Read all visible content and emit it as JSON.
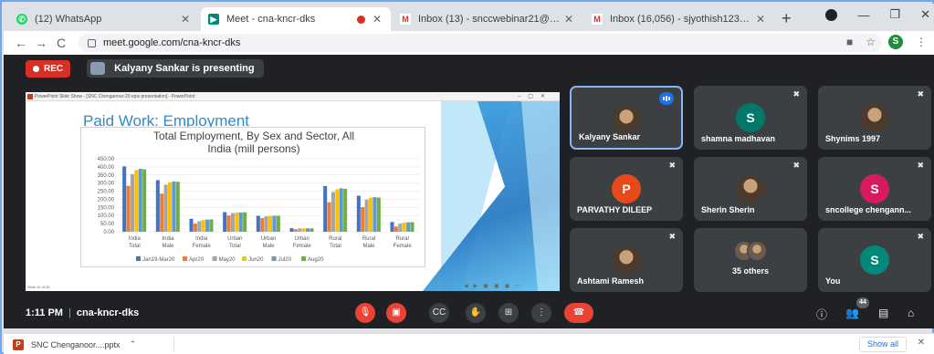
{
  "browser": {
    "tabs": [
      {
        "title": "(12) WhatsApp",
        "favicon": "whatsapp-icon",
        "color": "#25d366"
      },
      {
        "title": "Meet - cna-kncr-dks",
        "favicon": "meet-icon",
        "color": "#00897b"
      },
      {
        "title": "Inbox (13) - snccwebinar21@gm",
        "favicon": "gmail-icon",
        "color": "#d93025"
      },
      {
        "title": "Inbox (16,056) - sjyothish123@g",
        "favicon": "gmail-icon",
        "color": "#d93025"
      }
    ],
    "url": "meet.google.com/cna-kncr-dks",
    "profile_initial": "S"
  },
  "meet": {
    "rec_label": "REC",
    "presenting_label": "Kalyany Sankar is presenting",
    "time": "1:11 PM",
    "meeting_code": "cna-kncr-dks",
    "participant_count": "44"
  },
  "slide": {
    "window_title": "PowerPoint Slide Show - [SNC Chengannur-20 epis presentation] - PowerPoint",
    "title": "Paid Work: Employment",
    "footer": "Slide 10 of 45"
  },
  "chart_data": {
    "type": "bar",
    "title": "Total Employment, By Sex and Sector, All India (mill persons)",
    "categories": [
      [
        "India",
        "Total"
      ],
      [
        "India",
        "Male"
      ],
      [
        "India",
        "Female"
      ],
      [
        "Urban",
        "Total"
      ],
      [
        "Urban",
        "Male"
      ],
      [
        "Urban",
        "Female"
      ],
      [
        "Rural",
        "Total"
      ],
      [
        "Rural",
        "Male"
      ],
      [
        "Rural",
        "Female"
      ]
    ],
    "yticks": [
      "450.00",
      "400.00",
      "350.00",
      "300.00",
      "250.00",
      "200.00",
      "150.00",
      "100.00",
      "50.00",
      "0.00"
    ],
    "ylim": [
      0,
      450
    ],
    "series": [
      {
        "name": "Jan19-Mar20",
        "color": "#4472c4",
        "values": [
          403,
          318,
          80,
          121,
          98,
          22,
          282,
          222,
          60
        ]
      },
      {
        "name": "Apr20",
        "color": "#ed7d31",
        "values": [
          283,
          235,
          50,
          100,
          85,
          15,
          182,
          152,
          32
        ]
      },
      {
        "name": "May20",
        "color": "#a5a5a5",
        "values": [
          355,
          290,
          65,
          115,
          95,
          20,
          245,
          198,
          50
        ]
      },
      {
        "name": "Jun20",
        "color": "#ffc000",
        "values": [
          380,
          305,
          72,
          118,
          97,
          21,
          262,
          210,
          56
        ]
      },
      {
        "name": "Jul20",
        "color": "#5b9bd5",
        "values": [
          388,
          310,
          75,
          119,
          98,
          21,
          268,
          213,
          58
        ]
      },
      {
        "name": "Aug20",
        "color": "#70ad47",
        "values": [
          385,
          308,
          76,
          120,
          98,
          21,
          265,
          211,
          59
        ]
      }
    ]
  },
  "participants": [
    {
      "name": "Kalyany Sankar",
      "initial": "",
      "color": "",
      "speaking": true,
      "muted": false
    },
    {
      "name": "shamna madhavan",
      "initial": "S",
      "color": "#00796b",
      "speaking": false,
      "muted": true
    },
    {
      "name": "Shynims 1997",
      "initial": "",
      "color": "",
      "speaking": false,
      "muted": true
    },
    {
      "name": "PARVATHY DILEEP",
      "initial": "P",
      "color": "#e64a19",
      "speaking": false,
      "muted": true
    },
    {
      "name": "Sherin Sherin",
      "initial": "",
      "color": "",
      "speaking": false,
      "muted": true
    },
    {
      "name": "sncollege chengann...",
      "initial": "S",
      "color": "#d81b60",
      "speaking": false,
      "muted": true
    },
    {
      "name": "Ashtami Ramesh",
      "initial": "",
      "color": "",
      "speaking": false,
      "muted": true
    },
    {
      "name": "35 others",
      "initial": "",
      "color": "",
      "speaking": false,
      "muted": false
    },
    {
      "name": "You",
      "initial": "S",
      "color": "#00897b",
      "speaking": false,
      "muted": true
    }
  ],
  "downloads": {
    "file": "SNC Chenganoor....pptx",
    "show_all": "Show all"
  }
}
